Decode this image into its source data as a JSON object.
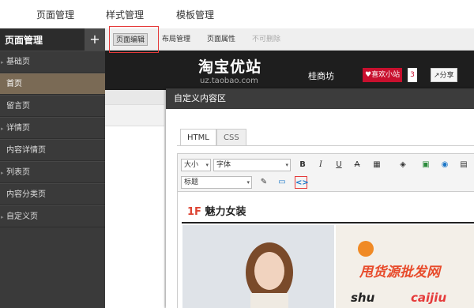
{
  "topnav": {
    "items": [
      "页面管理",
      "样式管理",
      "模板管理"
    ]
  },
  "sidebar": {
    "title": "页面管理",
    "add_label": "+",
    "items": [
      {
        "label": "基础页",
        "has_arrow": true
      },
      {
        "label": "首页",
        "has_arrow": false,
        "active": true
      },
      {
        "label": "留言页",
        "has_arrow": false
      },
      {
        "label": "详情页",
        "has_arrow": true
      },
      {
        "label": "内容详情页",
        "has_arrow": false
      },
      {
        "label": "列表页",
        "has_arrow": true
      },
      {
        "label": "内容分类页",
        "has_arrow": false
      },
      {
        "label": "自定义页",
        "has_arrow": true
      }
    ],
    "collapse_label": "‹"
  },
  "toolbar": {
    "buttons": [
      "页面编辑",
      "布局管理",
      "页面属性",
      "不可删除"
    ]
  },
  "preview": {
    "logo": "淘宝优站",
    "url": "uz.taobao.com",
    "shop_name": "桂商坊",
    "like_label": "♥喜欢小站",
    "like_count": "3",
    "share_label": "分享"
  },
  "dialog": {
    "title": "自定义内容区",
    "tabs": [
      "HTML",
      "CSS"
    ],
    "editor": {
      "size_select": "大小",
      "font_select": "字体",
      "format_select": "标题",
      "buttons": {
        "bold": "B",
        "italic": "I",
        "underline": "U",
        "strike": "A",
        "source": "<>"
      },
      "floor_number": "1F",
      "floor_title": "魅力女装",
      "overlay_text": "甩货源批发网"
    }
  },
  "watermark": {
    "text1": "shu",
    "text2": "caijiu"
  },
  "colors": {
    "sidebar_bg": "#3a3a3a",
    "active_item": "#7a6a55",
    "highlight": "#e53a3a",
    "like_red": "#c8102e"
  }
}
